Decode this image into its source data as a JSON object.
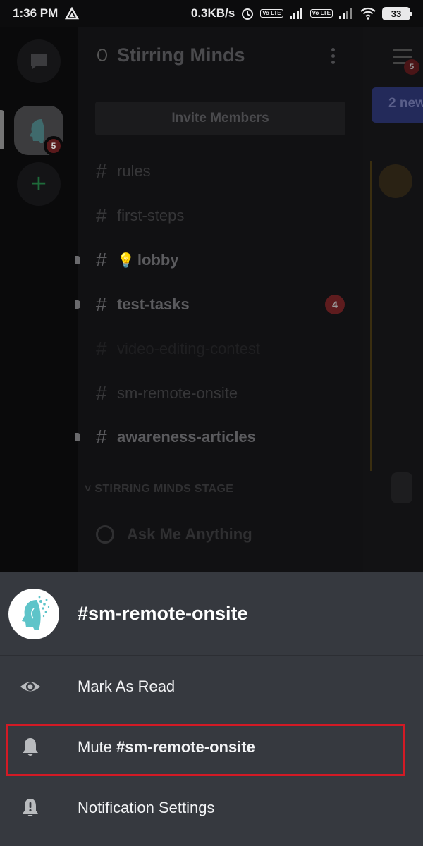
{
  "status_bar": {
    "time": "1:36 PM",
    "speed": "0.3KB/s",
    "volte1": "Vo LTE",
    "volte2": "Vo LTE",
    "battery": "33"
  },
  "guild_sidebar": {
    "server_badge": "5"
  },
  "channel_list": {
    "server_name": "Stirring Minds",
    "invite_label": "Invite Members",
    "channels": [
      {
        "name": "rules"
      },
      {
        "name": "first-steps"
      },
      {
        "name": "lobby",
        "emoji": "💡"
      },
      {
        "name": "test-tasks",
        "badge": "4"
      },
      {
        "name": "video-editing-contest"
      },
      {
        "name": "sm-remote-onsite"
      },
      {
        "name": "awareness-articles"
      }
    ],
    "category": "STIRRING MINDS STAGE",
    "stage_channel": "Ask Me Anything"
  },
  "chat_peek": {
    "hamburger_badge": "5",
    "new_messages": "2 new"
  },
  "sheet": {
    "title": "#sm-remote-onsite",
    "items": [
      {
        "label": "Mark As Read",
        "icon": "eye-icon"
      },
      {
        "label": "Mute ",
        "label_bold": "#sm-remote-onsite",
        "icon": "bell-icon"
      },
      {
        "label": "Notification Settings",
        "icon": "bell-alert-icon"
      }
    ]
  },
  "colors": {
    "sheet_bg": "#36393f",
    "highlight": "#d31a25",
    "accent_teal": "#5ec4c9"
  }
}
